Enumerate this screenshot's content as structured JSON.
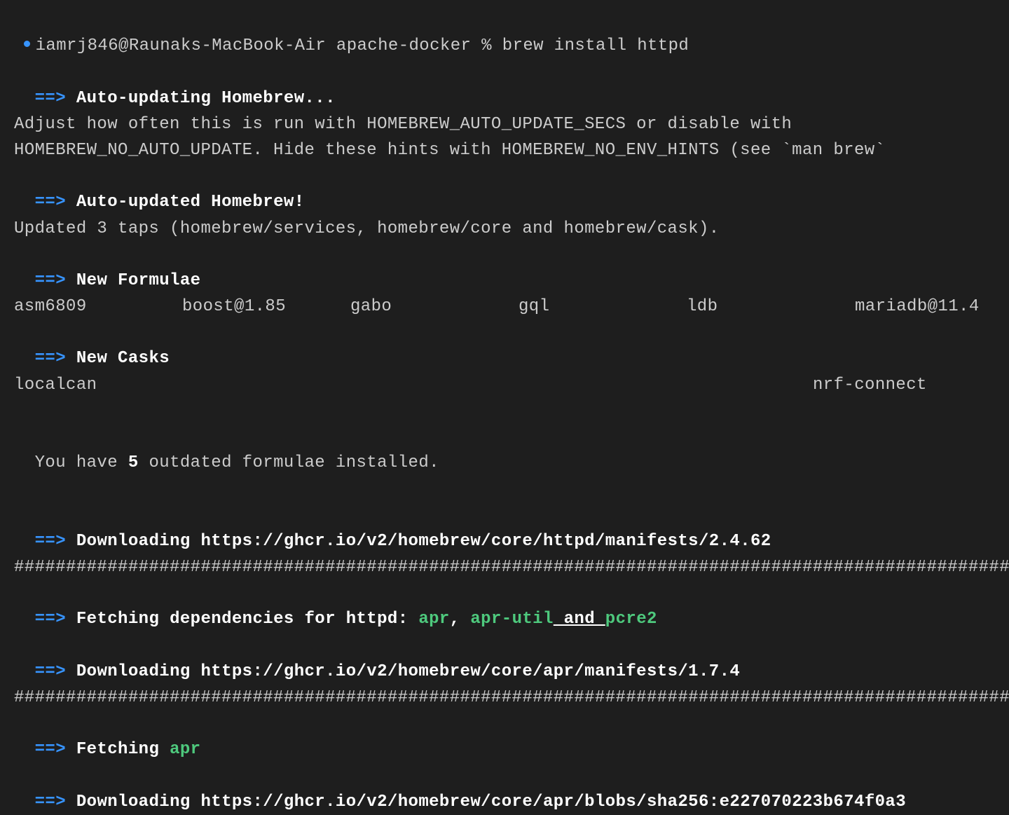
{
  "prompt": {
    "user_host": "iamrj846@Raunaks-MacBook-Air",
    "cwd": "apache-docker",
    "symbol": "%",
    "command": "brew install httpd"
  },
  "sections": {
    "arrow": "==>",
    "auto_updating": "Auto-updating Homebrew...",
    "adjust_hint_line1": "Adjust how often this is run with HOMEBREW_AUTO_UPDATE_SECS or disable with",
    "adjust_hint_line2": "HOMEBREW_NO_AUTO_UPDATE. Hide these hints with HOMEBREW_NO_ENV_HINTS (see `man brew`",
    "auto_updated": "Auto-updated Homebrew!",
    "updated_taps": "Updated 3 taps (homebrew/services, homebrew/core and homebrew/cask).",
    "new_formulae": "New Formulae",
    "formulae": [
      "asm6809",
      "boost@1.85",
      "gabo",
      "gql",
      "ldb",
      "mariadb@11.4"
    ],
    "new_casks": "New Casks",
    "casks": [
      "localcan",
      "nrf-connect"
    ],
    "outdated_prefix": "You have ",
    "outdated_count": "5",
    "outdated_suffix": " outdated formulae installed.",
    "download1": "Downloading https://ghcr.io/v2/homebrew/core/httpd/manifests/2.4.62",
    "progress_bar": "#########################################################################################################",
    "fetching_deps_prefix": "Fetching dependencies for httpd: ",
    "deps": {
      "d1": "apr",
      "sep1": ", ",
      "d2": "apr-util",
      "and": " and ",
      "d3": "pcre2"
    },
    "download2": "Downloading https://ghcr.io/v2/homebrew/core/apr/manifests/1.7.4",
    "fetching_apr_prefix": "Fetching ",
    "fetching_apr_pkg": "apr",
    "download3": "Downloading https://ghcr.io/v2/homebrew/core/apr/blobs/sha256:e227070223b674f0a3"
  }
}
